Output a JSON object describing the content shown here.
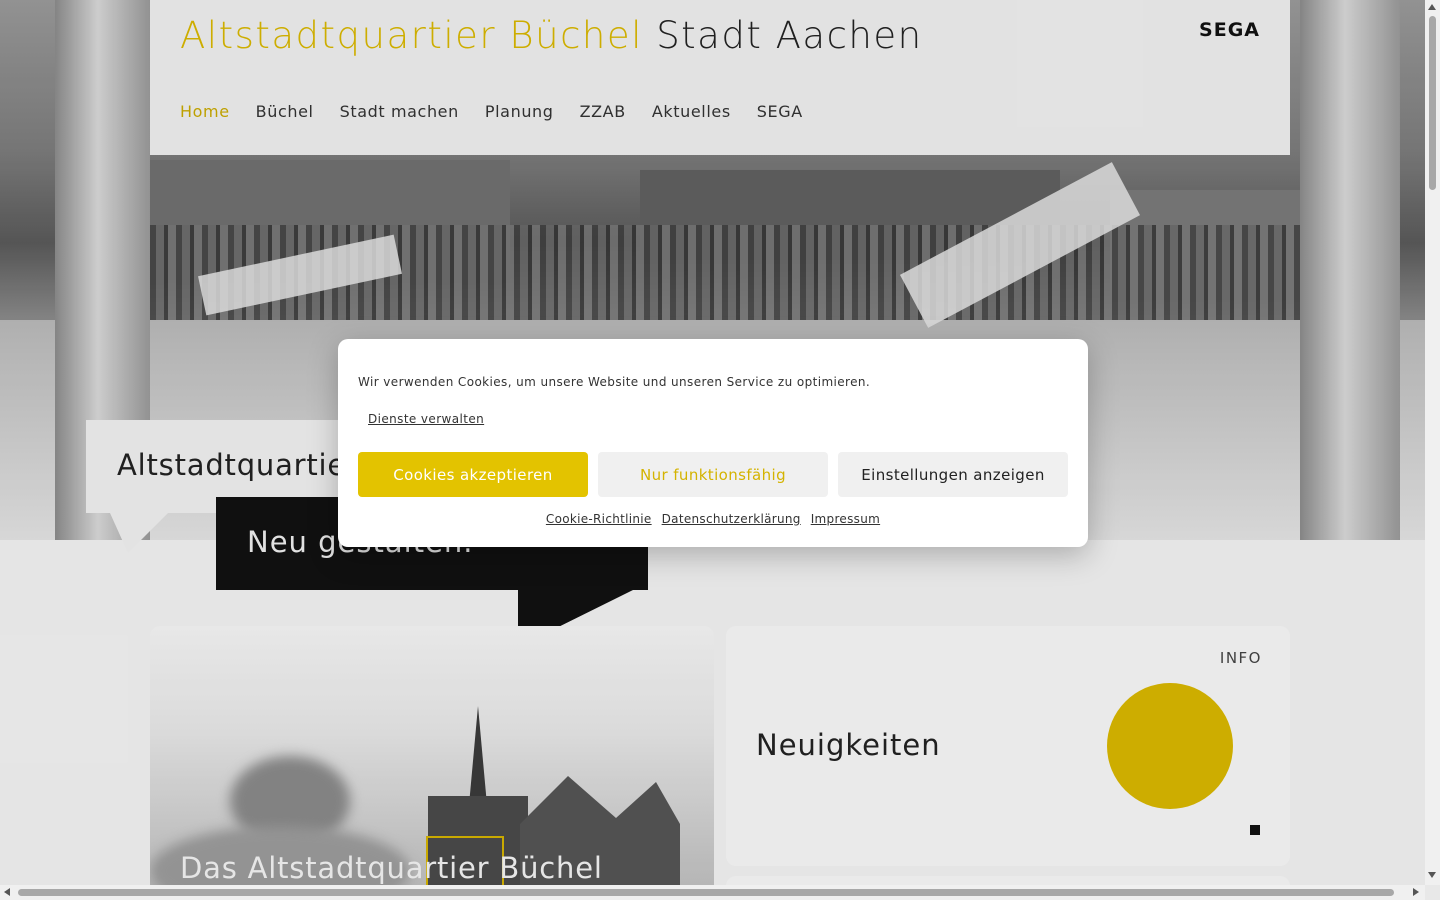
{
  "header": {
    "title_part1": "Altstadtquartier Büchel",
    "title_part2": "Stadt Aachen",
    "logo": "SEGA"
  },
  "nav": {
    "items": [
      {
        "label": "Home",
        "active": true
      },
      {
        "label": "Büchel",
        "active": false
      },
      {
        "label": "Stadt machen",
        "active": false
      },
      {
        "label": "Planung",
        "active": false
      },
      {
        "label": "ZZAB",
        "active": false
      },
      {
        "label": "Aktuelles",
        "active": false
      },
      {
        "label": "SEGA",
        "active": false
      }
    ]
  },
  "hero": {
    "headline": "Altstadtquartier",
    "subline": "Neu gestalten."
  },
  "cards": {
    "left_title": "Das Altstadtquartier Büchel",
    "right_label": "INFO",
    "right_title": "Neuigkeiten"
  },
  "cookie": {
    "message": "Wir verwenden Cookies, um unsere Website und unseren Service zu optimieren.",
    "manage": "Dienste verwalten",
    "accept": "Cookies akzeptieren",
    "functional": "Nur funktionsfähig",
    "settings": "Einstellungen anzeigen",
    "links": [
      "Cookie-Richtlinie",
      "Datenschutzerklärung",
      "Impressum"
    ]
  },
  "colors": {
    "accent": "#d9b700",
    "button_accept": "#e3c300",
    "dark": "#111111"
  }
}
